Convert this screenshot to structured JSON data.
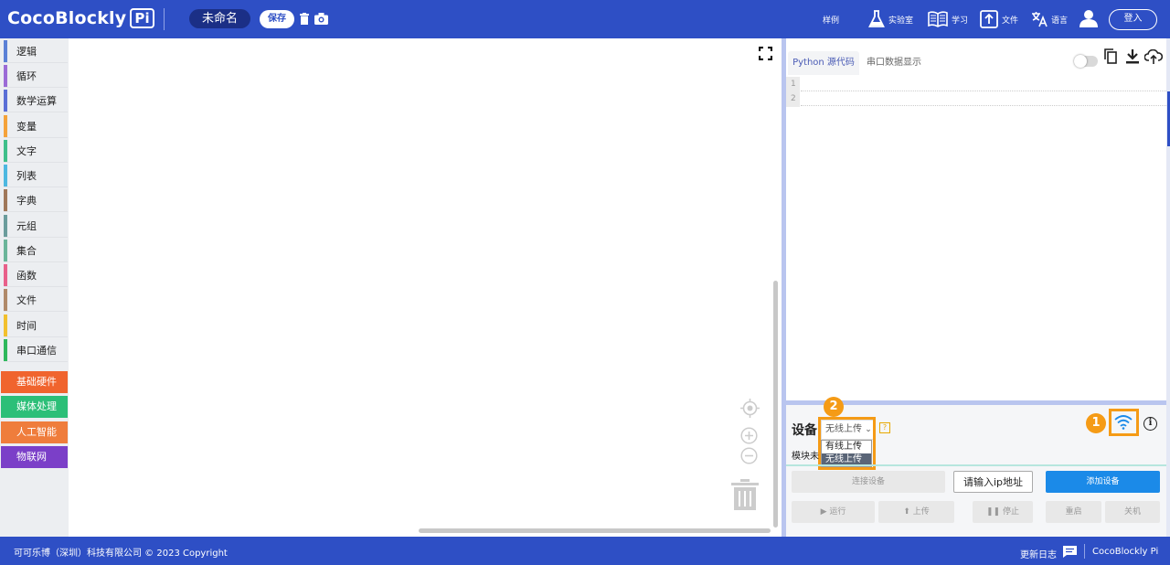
{
  "header": {
    "brand": "CocoBlockly",
    "brand_suffix": "Pi",
    "project_name": "未命名",
    "save_label": "保存",
    "nav": {
      "samples": "样例",
      "lab": "实验室",
      "learn": "学习",
      "file": "文件",
      "language": "语言"
    },
    "login_label": "登入"
  },
  "sidebar": {
    "categories": [
      {
        "label": "逻辑",
        "color": "#5b80d6"
      },
      {
        "label": "循环",
        "color": "#9b6bd6"
      },
      {
        "label": "数学运算",
        "color": "#5b6fd6"
      },
      {
        "label": "变量",
        "color": "#f4a23a"
      },
      {
        "label": "文字",
        "color": "#3fbf8a"
      },
      {
        "label": "列表",
        "color": "#4db8e0"
      },
      {
        "label": "字典",
        "color": "#a0785a"
      },
      {
        "label": "元组",
        "color": "#6b9c9c"
      },
      {
        "label": "集合",
        "color": "#6bb59a"
      },
      {
        "label": "函数",
        "color": "#e8608a"
      },
      {
        "label": "文件",
        "color": "#b08a6a"
      },
      {
        "label": "时间",
        "color": "#f2c02e"
      },
      {
        "label": "串口通信",
        "color": "#2eb85c"
      }
    ],
    "hardware": [
      {
        "label": "基础硬件",
        "color": "#f0642e"
      },
      {
        "label": "媒体处理",
        "color": "#2cbf78"
      },
      {
        "label": "人工智能",
        "color": "#ef7d3c"
      },
      {
        "label": "物联网",
        "color": "#7b3fc8"
      }
    ]
  },
  "code_panel": {
    "tabs": [
      "Python 源代码",
      "串口数据显示"
    ],
    "line_numbers": [
      "1",
      "2"
    ]
  },
  "device_panel": {
    "title": "设备",
    "upload_mode_selected": "无线上传",
    "upload_mode_options": [
      "有线上传",
      "无线上传"
    ],
    "help_glyph": "?",
    "module_status": "模块未",
    "annotations": [
      "1",
      "2"
    ],
    "buttons": {
      "connect": "连接设备",
      "ip_placeholder": "请输入ip地址",
      "add_device": "添加设备",
      "run": "运行",
      "upload": "上传",
      "stop": "停止",
      "restart": "重启",
      "shutdown": "关机"
    }
  },
  "footer": {
    "copyright": "可可乐博（深圳）科技有限公司 © 2023 Copyright",
    "changelog": "更新日志",
    "brand": "CocoBlockly Pi"
  },
  "colors": {
    "primary": "#2e4fc5",
    "highlight": "#f59b16",
    "add_device": "#1b8ae8"
  }
}
